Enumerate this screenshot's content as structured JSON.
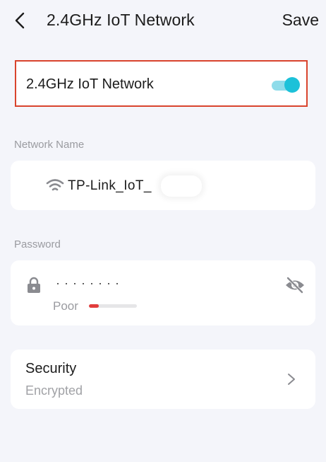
{
  "header": {
    "title": "2.4GHz IoT Network",
    "save_label": "Save"
  },
  "toggle": {
    "label": "2.4GHz IoT Network",
    "enabled": true,
    "color": "#1cc1d9",
    "highlight_border_color": "#d9442d"
  },
  "network_name": {
    "section_label": "Network Name",
    "value": "TP-Link_IoT_",
    "icon": "wifi-icon"
  },
  "password": {
    "section_label": "Password",
    "masked_value": "········",
    "strength_label": "Poor",
    "strength_level": 0.2,
    "strength_color": "#e23c3c",
    "lock_icon": "lock-icon",
    "visibility_icon": "eye-off-icon"
  },
  "security": {
    "title": "Security",
    "value": "Encrypted"
  }
}
